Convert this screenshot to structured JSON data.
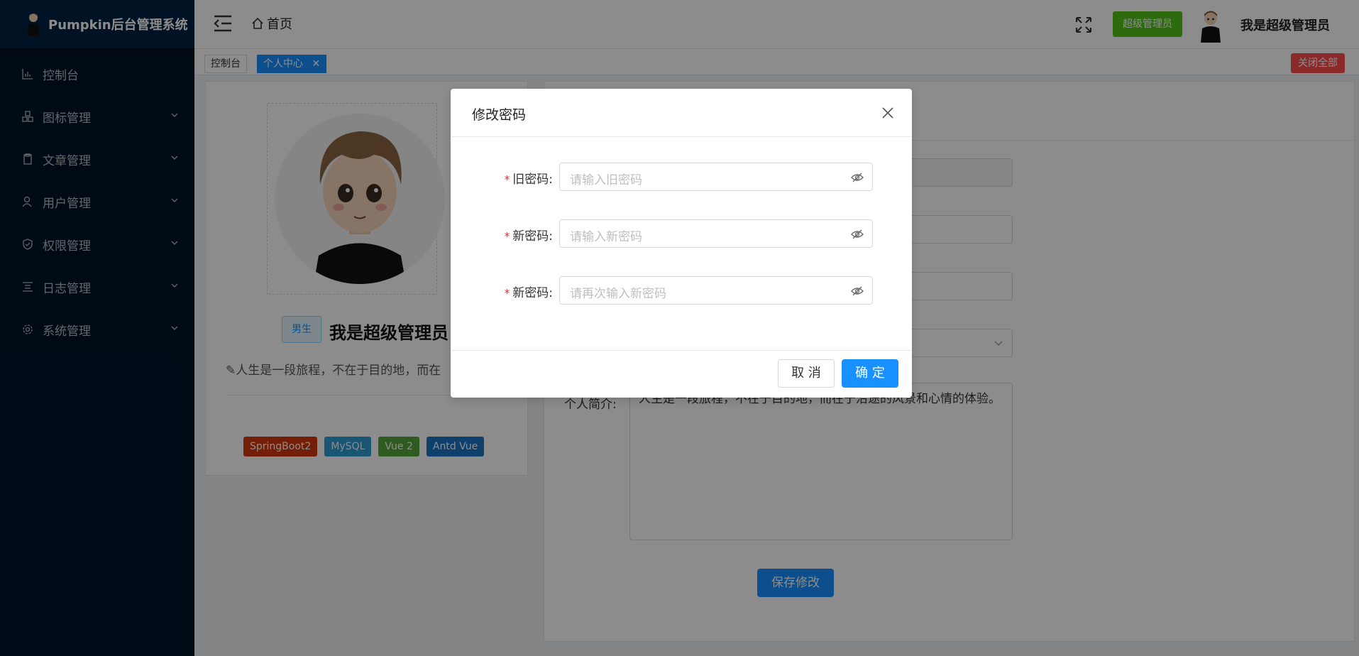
{
  "app": {
    "title": "Pumpkin后台管理系统"
  },
  "sidebar": {
    "items": [
      {
        "label": "控制台",
        "icon": "dashboard-icon",
        "has_children": false
      },
      {
        "label": "图标管理",
        "icon": "apps-icon",
        "has_children": true
      },
      {
        "label": "文章管理",
        "icon": "document-icon",
        "has_children": true
      },
      {
        "label": "用户管理",
        "icon": "user-icon",
        "has_children": true
      },
      {
        "label": "权限管理",
        "icon": "shield-icon",
        "has_children": true
      },
      {
        "label": "日志管理",
        "icon": "log-icon",
        "has_children": true
      },
      {
        "label": "系统管理",
        "icon": "gear-icon",
        "has_children": true
      }
    ]
  },
  "header": {
    "breadcrumb_home": "首页",
    "role_badge": "超级管理员",
    "username": "我是超级管理员"
  },
  "tabs": {
    "items": [
      {
        "label": "控制台",
        "active": false
      },
      {
        "label": "个人中心",
        "active": true
      }
    ],
    "close_all": "关闭全部"
  },
  "profile": {
    "gender": "男生",
    "name": "我是超级管理员",
    "motto": "人生是一段旅程，不在于目的地，而在",
    "tech_tags": [
      {
        "label": "SpringBoot2",
        "color": "#d4380d"
      },
      {
        "label": "MySQL",
        "color": "#2f9bd6"
      },
      {
        "label": "Vue 2",
        "color": "#52a63b"
      },
      {
        "label": "Antd Vue",
        "color": "#1a73c7"
      }
    ]
  },
  "info": {
    "bio_label": "个人简介:",
    "bio_text": "人生是一段旅程，不在于目的地，而在于沿途的风景和心情的体验。",
    "save_button": "保存修改"
  },
  "modal": {
    "title": "修改密码",
    "fields": [
      {
        "label": "旧密码:",
        "placeholder": "请输入旧密码"
      },
      {
        "label": "新密码:",
        "placeholder": "请输入新密码"
      },
      {
        "label": "新密码:",
        "placeholder": "请再次输入新密码"
      }
    ],
    "cancel": "取 消",
    "ok": "确 定"
  },
  "colors": {
    "sidebar_bg": "#001529",
    "primary": "#1890ff",
    "success": "#52c41a",
    "danger": "#ff4d4f"
  }
}
